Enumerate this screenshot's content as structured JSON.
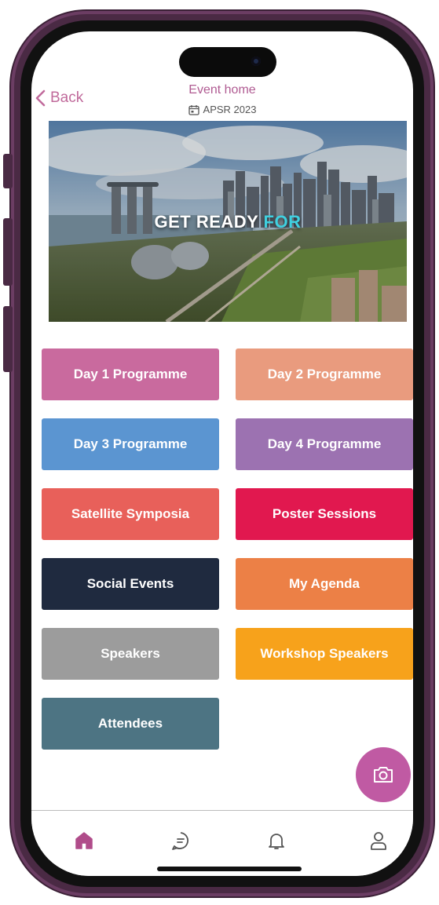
{
  "header": {
    "back_label": "Back",
    "title": "Event home",
    "event_name": "APSR 2023"
  },
  "banner": {
    "text_main": "GET READY ",
    "text_accent": "FOR"
  },
  "tiles": [
    {
      "label": "Day 1 Programme",
      "color": "#c96a9e"
    },
    {
      "label": "Day 2 Programme",
      "color": "#e99b7e"
    },
    {
      "label": "Day 3 Programme",
      "color": "#5b95d1"
    },
    {
      "label": "Day 4 Programme",
      "color": "#9c72b1"
    },
    {
      "label": "Satellite Symposia",
      "color": "#e8605a"
    },
    {
      "label": "Poster Sessions",
      "color": "#e1184f"
    },
    {
      "label": "Social Events",
      "color": "#1f2a3f"
    },
    {
      "label": "My Agenda",
      "color": "#ec8046"
    },
    {
      "label": "Speakers",
      "color": "#9c9c9c"
    },
    {
      "label": "Workshop Speakers",
      "color": "#f7a21b"
    },
    {
      "label": "Attendees",
      "color": "#4d7483"
    }
  ],
  "fab": {
    "icon": "camera-icon",
    "color": "#c05aa3"
  },
  "nav": [
    {
      "icon": "home-icon",
      "active": true
    },
    {
      "icon": "chat-icon",
      "active": false
    },
    {
      "icon": "bell-icon",
      "active": false
    },
    {
      "icon": "user-icon",
      "active": false
    }
  ],
  "colors": {
    "accent": "#c06a9b",
    "active_nav": "#b04c8a"
  }
}
